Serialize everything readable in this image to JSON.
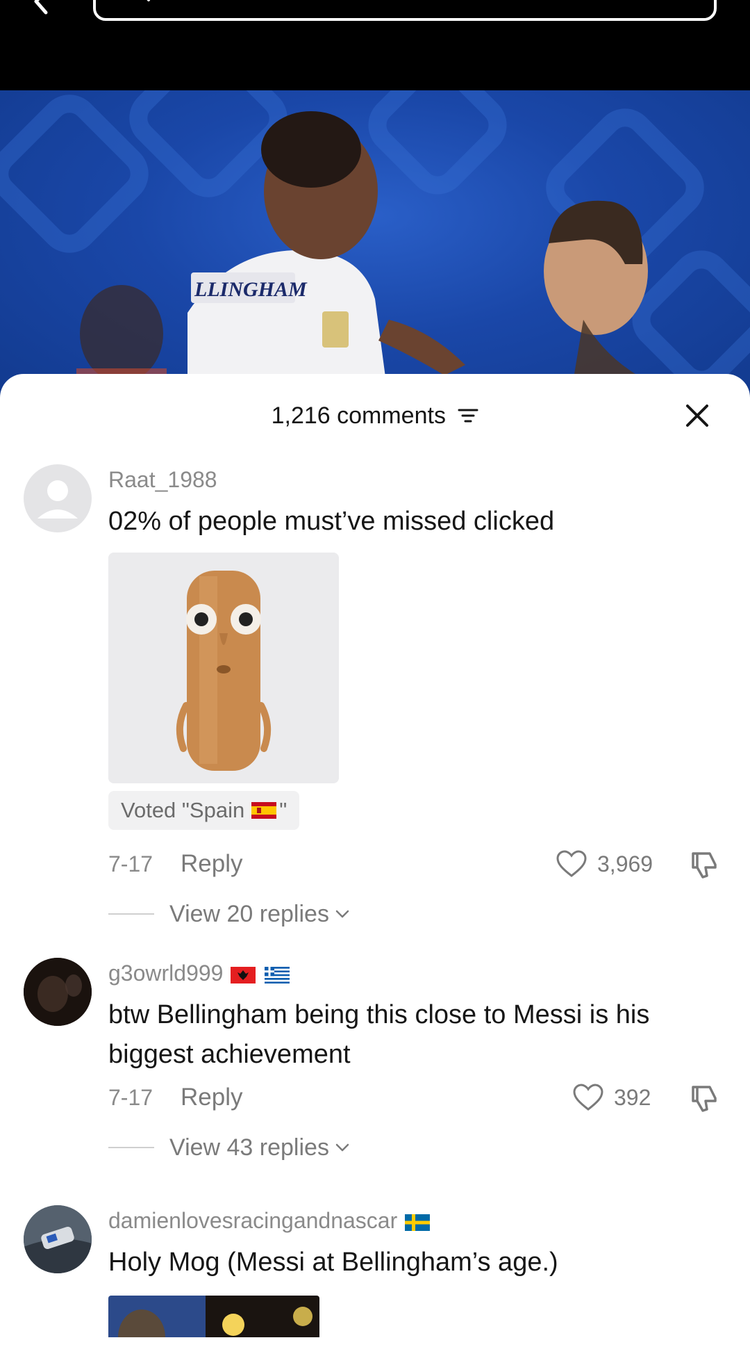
{
  "search": {
    "placeholder": ""
  },
  "video": {
    "jersey_text": "LLINGHAM"
  },
  "sheet": {
    "comment_count": "1,216 comments",
    "close_label": "×"
  },
  "comments": [
    {
      "username": "Raat_1988",
      "text": "02% of people must’ve missed clicked",
      "vote_label": "Voted \"Spain",
      "vote_suffix": "\"",
      "date": "7-17",
      "reply_label": "Reply",
      "likes": "3,969",
      "view_replies": "View 20 replies"
    },
    {
      "username": "g3owrld999",
      "text": "btw Bellingham being this close to Messi is his biggest achievement",
      "date": "7-17",
      "reply_label": "Reply",
      "likes": "392",
      "view_replies": "View 43 replies"
    },
    {
      "username": "damienlovesracingandnascar",
      "text": "Holy Mog (Messi at Bellingham’s age.)"
    }
  ],
  "colors": {
    "text_primary": "#161616",
    "text_secondary": "#8a8a8a",
    "video_bg": "#1a47a8"
  }
}
